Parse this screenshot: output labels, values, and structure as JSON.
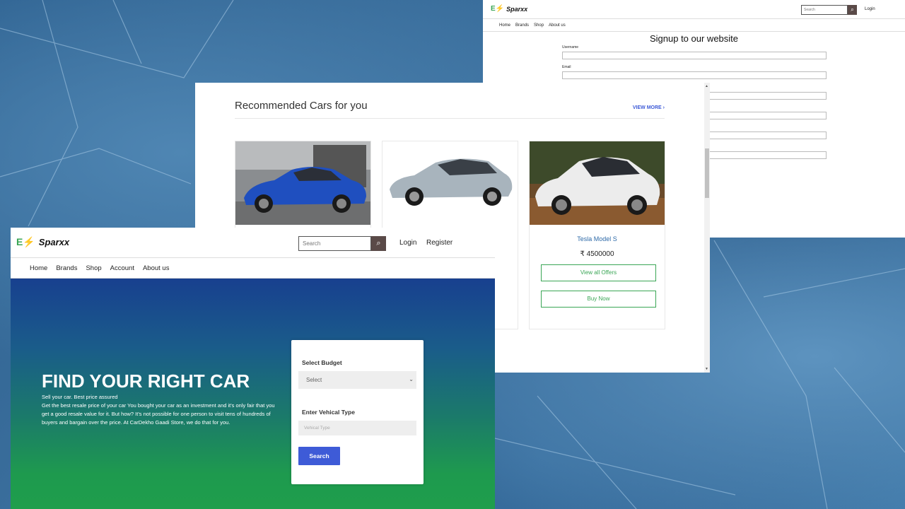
{
  "signup_window": {
    "brand": {
      "logo": "E⚡",
      "name": "Sparxx"
    },
    "search_placeholder": "Search",
    "search_icon": "search-icon",
    "login": "Login",
    "menu": [
      "Home",
      "Brands",
      "Shop",
      "About us"
    ],
    "title": "Signup to our website",
    "fields": [
      {
        "label": "Username",
        "value": ""
      },
      {
        "label": "Email",
        "value": ""
      }
    ]
  },
  "recommended_window": {
    "title": "Recommended Cars for you",
    "view_more": "VIEW MORE",
    "view_more_icon": "chevron-right-icon",
    "cards": [
      {
        "name": "",
        "price": "",
        "car_color": "#1f4fbf"
      },
      {
        "name": "",
        "price": "",
        "car_color": "#a8b4bd"
      },
      {
        "name": "Tesla Model S",
        "price": "₹ 4500000",
        "car_color": "#e8e8e8",
        "offers_label": "View all Offers",
        "buy_label": "Buy Now"
      }
    ]
  },
  "hero_window": {
    "brand": {
      "logo": "E⚡",
      "name": "Sparxx"
    },
    "search_placeholder": "Search",
    "search_icon": "search-icon",
    "login": "Login",
    "register": "Register",
    "menu": [
      "Home",
      "Brands",
      "Shop",
      "Account",
      "About us"
    ],
    "title": "FIND YOUR RIGHT CAR",
    "subtitle": "Sell your car. Best price assured",
    "description": "Get the best resale price of your car You bought your car as an investment and it's only fair that you get a good resale value for it. But how? It's not possible for one person to visit tens of hundreds of buyers and bargain over the price. At CarDekho Gaadi Store, we do that for you.",
    "form": {
      "budget_label": "Select Budget",
      "budget_value": "Select",
      "type_label": "Enter Vehical Type",
      "type_placeholder": "Vehical Type",
      "search_button": "Search"
    }
  },
  "colors": {
    "accent_green": "#3aa655",
    "accent_blue": "#3e5bd7",
    "link_blue": "#2e6aa8"
  }
}
